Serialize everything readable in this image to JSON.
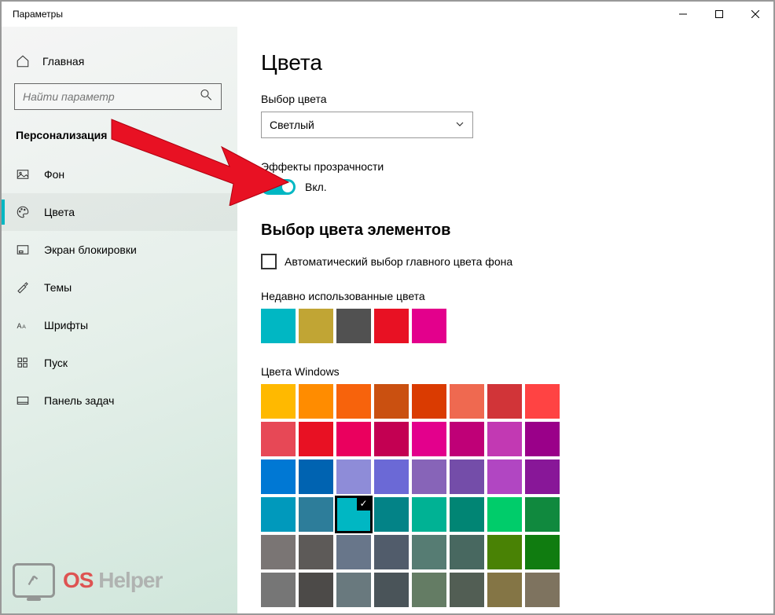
{
  "window": {
    "title": "Параметры"
  },
  "sidebar": {
    "home": "Главная",
    "search_placeholder": "Найти параметр",
    "section": "Персонализация",
    "items": [
      {
        "label": "Фон"
      },
      {
        "label": "Цвета"
      },
      {
        "label": "Экран блокировки"
      },
      {
        "label": "Темы"
      },
      {
        "label": "Шрифты"
      },
      {
        "label": "Пуск"
      },
      {
        "label": "Панель задач"
      }
    ]
  },
  "content": {
    "title": "Цвета",
    "color_choice_label": "Выбор цвета",
    "color_choice_value": "Светлый",
    "transparency_label": "Эффекты прозрачности",
    "transparency_state": "Вкл.",
    "accent_heading": "Выбор цвета элементов",
    "auto_pick_label": "Автоматический выбор главного цвета фона",
    "recent_label": "Недавно использованные цвета",
    "recent_colors": [
      "#00b7c3",
      "#c1a534",
      "#515151",
      "#e81123",
      "#e3008c"
    ],
    "windows_label": "Цвета Windows",
    "windows_colors": [
      "#ffb900",
      "#ff8c00",
      "#f7630c",
      "#ca5010",
      "#da3b01",
      "#ef6950",
      "#d13438",
      "#ff4343",
      "#e74856",
      "#e81123",
      "#ea005e",
      "#c30052",
      "#e3008c",
      "#bf0077",
      "#c239b3",
      "#9a0089",
      "#0078d4",
      "#0063b1",
      "#8e8cd8",
      "#6b69d6",
      "#8764b8",
      "#744da9",
      "#b146c2",
      "#881798",
      "#0099bc",
      "#2d7d9a",
      "#00b7c3",
      "#038387",
      "#00b294",
      "#018574",
      "#00cc6a",
      "#10893e",
      "#7a7574",
      "#5d5a58",
      "#68768a",
      "#515c6b",
      "#567c73",
      "#486860",
      "#498205",
      "#107c10",
      "#767676",
      "#4c4a48",
      "#69797e",
      "#4a5459",
      "#647c64",
      "#525e54",
      "#847545",
      "#7e735f"
    ],
    "selected_color_index": 26
  },
  "watermark": {
    "os": "OS",
    "helper": "Helper"
  }
}
